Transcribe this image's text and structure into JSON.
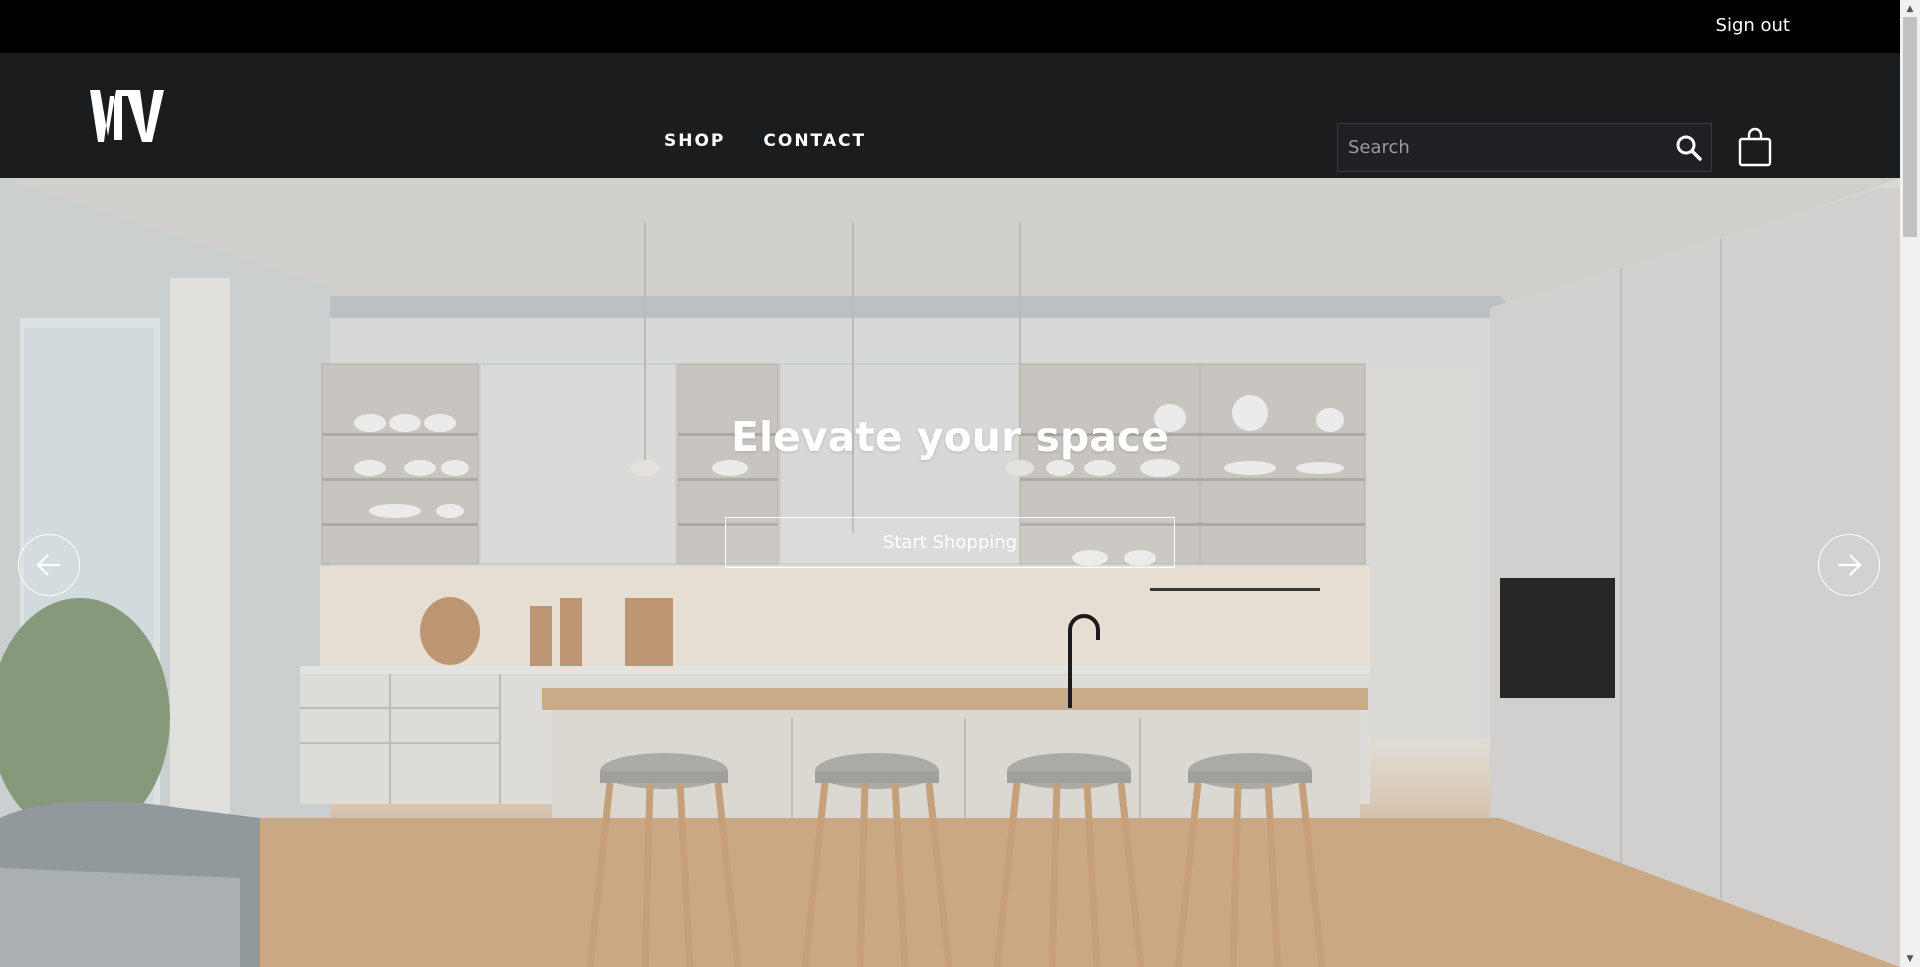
{
  "topbar": {
    "signout_label": "Sign out"
  },
  "header": {
    "logo_text": "VTV",
    "nav": [
      {
        "label": "SHOP"
      },
      {
        "label": "CONTACT"
      }
    ],
    "search": {
      "placeholder": "Search",
      "value": ""
    }
  },
  "hero": {
    "title": "Elevate your space",
    "cta_label": "Start Shopping"
  },
  "icons": {
    "search": "search-icon",
    "cart": "shopping-bag-icon",
    "prev": "arrow-left-icon",
    "next": "arrow-right-icon"
  }
}
